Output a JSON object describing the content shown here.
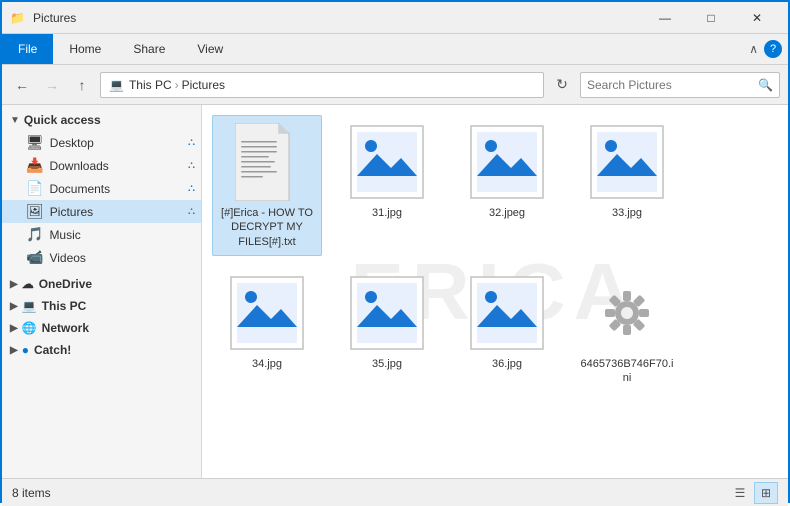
{
  "titleBar": {
    "title": "Pictures",
    "icons": [
      "📁"
    ],
    "minimize": "—",
    "maximize": "□",
    "close": "✕"
  },
  "ribbon": {
    "tabs": [
      "File",
      "Home",
      "Share",
      "View"
    ]
  },
  "addressBar": {
    "backDisabled": false,
    "forwardDisabled": true,
    "upPath": true,
    "pathParts": [
      "This PC",
      "Pictures"
    ],
    "refreshTitle": "Refresh",
    "searchPlaceholder": "Search Pictures"
  },
  "sidebar": {
    "quickAccess": {
      "label": "Quick access",
      "items": [
        {
          "name": "Desktop",
          "icon": "🖥",
          "pinned": true
        },
        {
          "name": "Downloads",
          "icon": "📥",
          "pinned": true
        },
        {
          "name": "Documents",
          "icon": "📄",
          "pinned": true
        },
        {
          "name": "Pictures",
          "icon": "🖼",
          "pinned": true,
          "active": true
        },
        {
          "name": "Music",
          "icon": "🎵",
          "pinned": false
        },
        {
          "name": "Videos",
          "icon": "📹",
          "pinned": false
        }
      ]
    },
    "items": [
      {
        "name": "OneDrive",
        "icon": "☁",
        "indent": false
      },
      {
        "name": "This PC",
        "icon": "💻",
        "indent": false
      },
      {
        "name": "Network",
        "icon": "🌐",
        "indent": false
      },
      {
        "name": "Catch!",
        "icon": "🔵",
        "indent": false
      }
    ]
  },
  "files": [
    {
      "name": "[#]Erica - HOW TO DECRYPT MY FILES[#].txt",
      "type": "txt",
      "selected": true
    },
    {
      "name": "31.jpg",
      "type": "img"
    },
    {
      "name": "32.jpeg",
      "type": "img"
    },
    {
      "name": "33.jpg",
      "type": "img"
    },
    {
      "name": "34.jpg",
      "type": "img"
    },
    {
      "name": "35.jpg",
      "type": "img"
    },
    {
      "name": "36.jpg",
      "type": "img"
    },
    {
      "name": "6465736B746F70.ini",
      "type": "gear"
    }
  ],
  "statusBar": {
    "itemCount": "8 items",
    "viewList": "≡",
    "viewLarge": "⊞"
  },
  "watermark": "ERICA"
}
